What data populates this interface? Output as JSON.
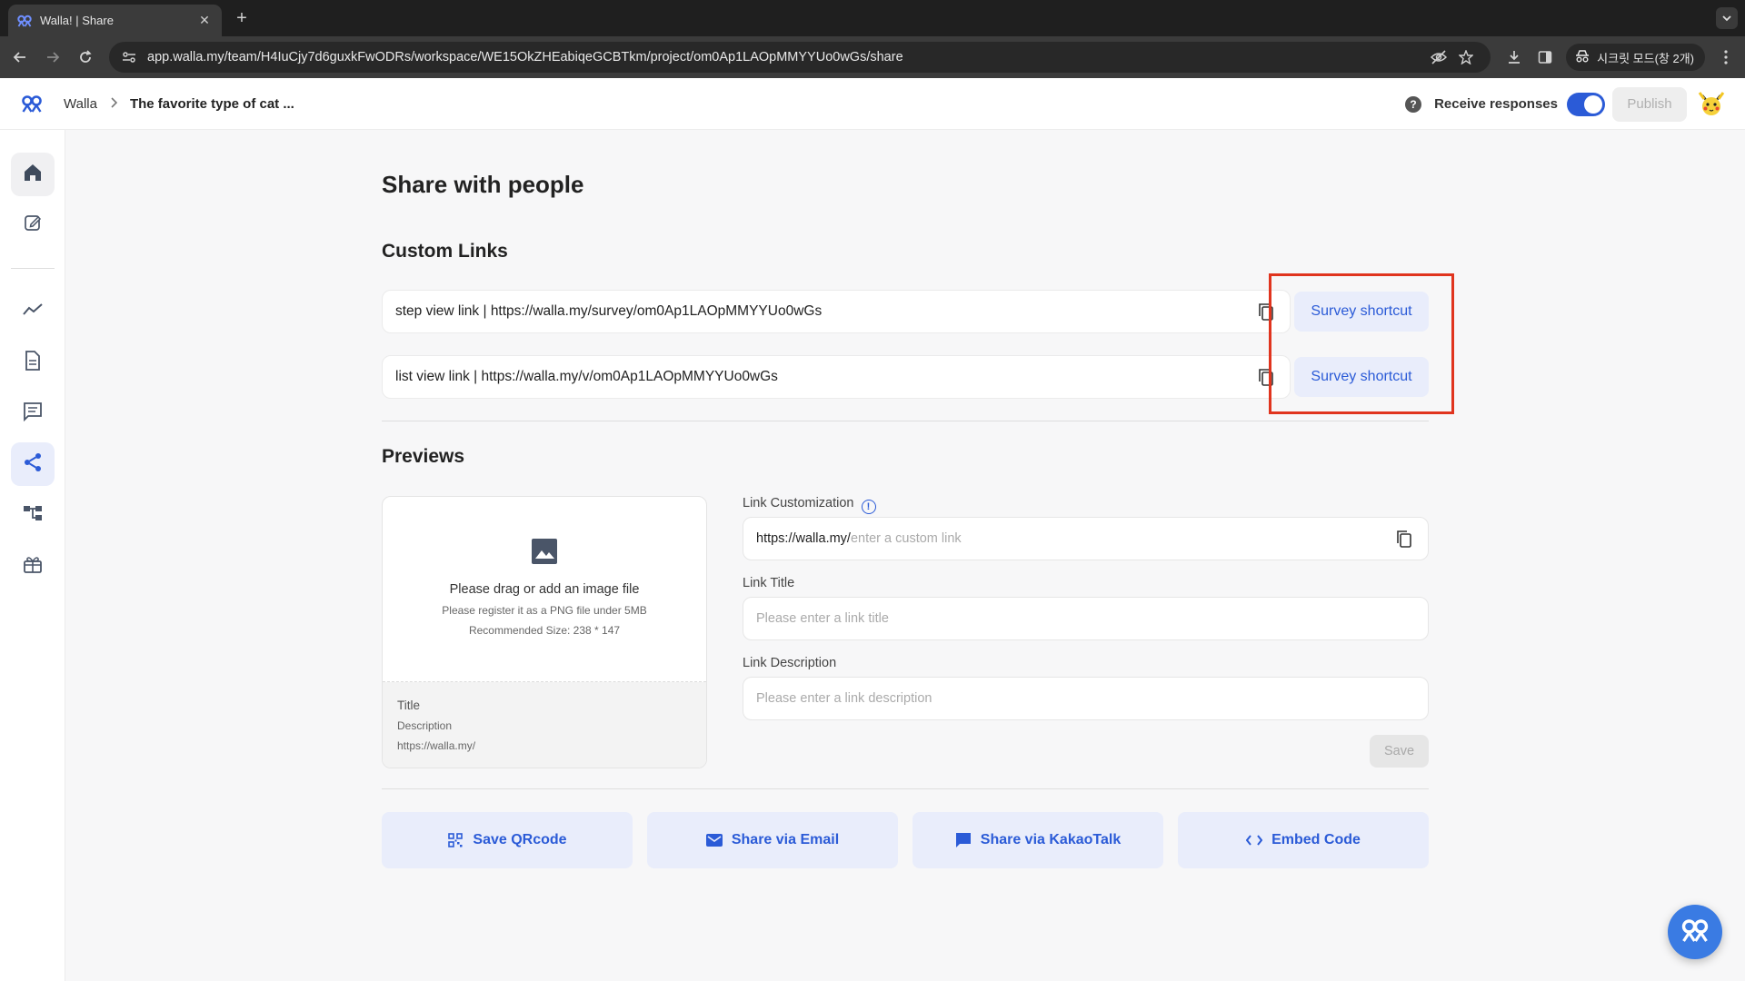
{
  "browser": {
    "tab_title": "Walla! | Share",
    "url": "app.walla.my/team/H4IuCjy7d6guxkFwODRs/workspace/WE15OkZHEabiqeGCBTkm/project/om0Ap1LAOpMMYYUo0wGs/share",
    "incognito_label": "시크릿 모드(창 2개)"
  },
  "header": {
    "breadcrumb_root": "Walla",
    "breadcrumb_current": "The favorite type of cat ...",
    "receive_label": "Receive responses",
    "receive_enabled": true,
    "publish_label": "Publish"
  },
  "sidebar": {
    "items": [
      "home",
      "edit",
      "analytics",
      "responses",
      "comments",
      "share",
      "integrations",
      "gift"
    ],
    "active": "share"
  },
  "main": {
    "page_title": "Share with people",
    "custom_links_title": "Custom Links",
    "links": [
      {
        "label": "step view link |  https://walla.my/survey/om0Ap1LAOpMMYYUo0wGs",
        "shortcut_label": "Survey shortcut"
      },
      {
        "label": "list view link |  https://walla.my/v/om0Ap1LAOpMMYYUo0wGs",
        "shortcut_label": "Survey shortcut"
      }
    ],
    "previews_title": "Previews",
    "preview_card": {
      "drop_title": "Please drag or add an image file",
      "drop_sub": "Please register it as a PNG file under 5MB",
      "drop_size": "Recommended Size: 238 * 147",
      "meta_title": "Title",
      "meta_desc": "Description",
      "meta_url": "https://walla.my/"
    },
    "form": {
      "customization_label": "Link Customization",
      "url_prefix": "https://walla.my/",
      "custom_placeholder": "enter a custom link",
      "title_label": "Link Title",
      "title_placeholder": "Please enter a link title",
      "desc_label": "Link Description",
      "desc_placeholder": "Please enter a link description",
      "save_label": "Save"
    },
    "actions": {
      "qr": "Save QRcode",
      "email": "Share via Email",
      "kakao": "Share via KakaoTalk",
      "embed": "Embed Code"
    }
  },
  "colors": {
    "accent": "#2b5bd7",
    "accent_light": "#e9edfb",
    "highlight": "#e0341e"
  }
}
